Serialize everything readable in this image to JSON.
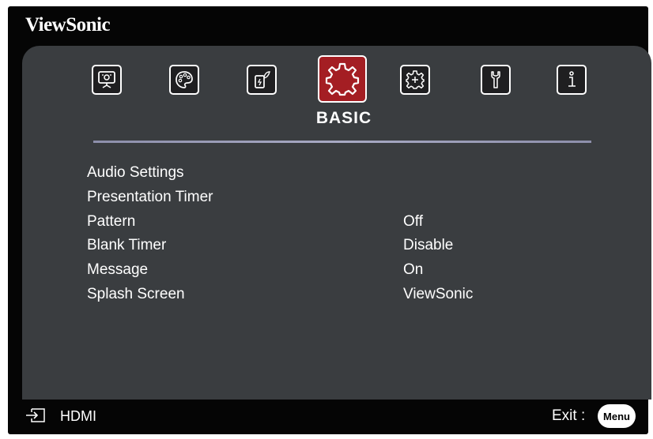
{
  "brand": "ViewSonic",
  "tabs": [
    {
      "icon": "display-icon",
      "active": false
    },
    {
      "icon": "color-palette-icon",
      "active": false
    },
    {
      "icon": "power-management-icon",
      "active": false
    },
    {
      "icon": "basic-settings-gear-icon",
      "active": true
    },
    {
      "icon": "advanced-settings-gear-icon",
      "active": false
    },
    {
      "icon": "system-wrench-icon",
      "active": false
    },
    {
      "icon": "information-icon",
      "active": false
    }
  ],
  "active_tab_title": "BASIC",
  "menu_items": [
    {
      "label": "Audio Settings",
      "value": ""
    },
    {
      "label": "Presentation Timer",
      "value": ""
    },
    {
      "label": "Pattern",
      "value": "Off"
    },
    {
      "label": "Blank Timer",
      "value": "Disable"
    },
    {
      "label": "Message",
      "value": "On"
    },
    {
      "label": "Splash Screen",
      "value": "ViewSonic"
    }
  ],
  "footer": {
    "source_icon": "input-source-icon",
    "source": "HDMI",
    "exit_label": "Exit :",
    "menu_key": "Menu"
  },
  "colors": {
    "background": "#050505",
    "panel": "#3a3d40",
    "active_tab": "#a41e23",
    "divider": "#a8aac4",
    "text": "#ffffff"
  }
}
